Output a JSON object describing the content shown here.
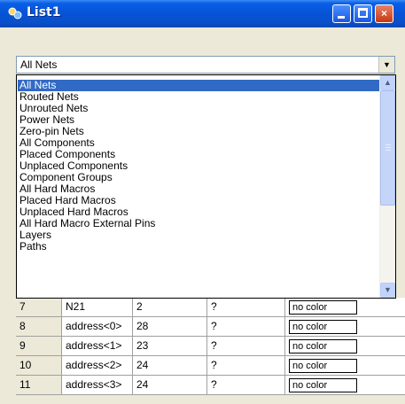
{
  "window": {
    "title": "List1",
    "app_icon": "app-icon",
    "controls": {
      "minimize": "minimize-icon",
      "maximize": "maximize-icon",
      "close": "×"
    }
  },
  "filter": {
    "selected": "All Nets",
    "arrow": "▼",
    "options": [
      "All Nets",
      "Routed Nets",
      "Unrouted Nets",
      "Power Nets",
      "Zero-pin Nets",
      "All Components",
      "Placed Components",
      "Unplaced Components",
      "Component Groups",
      "All Hard Macros",
      "Placed Hard Macros",
      "Unplaced Hard Macros",
      "All Hard Macro External Pins",
      "Layers",
      "Paths"
    ],
    "scroll_up": "▲",
    "scroll_down": "▼"
  },
  "rows": [
    {
      "index": "7",
      "name": "N21",
      "count": "2",
      "status": "?",
      "color": "no color"
    },
    {
      "index": "8",
      "name": "address<0>",
      "count": "28",
      "status": "?",
      "color": "no color"
    },
    {
      "index": "9",
      "name": "address<1>",
      "count": "23",
      "status": "?",
      "color": "no color"
    },
    {
      "index": "10",
      "name": "address<2>",
      "count": "24",
      "status": "?",
      "color": "no color"
    },
    {
      "index": "11",
      "name": "address<3>",
      "count": "24",
      "status": "?",
      "color": "no color"
    }
  ],
  "colors": {
    "titlebar": "#0553d6",
    "selection": "#316ac5",
    "face": "#ece9d8"
  }
}
